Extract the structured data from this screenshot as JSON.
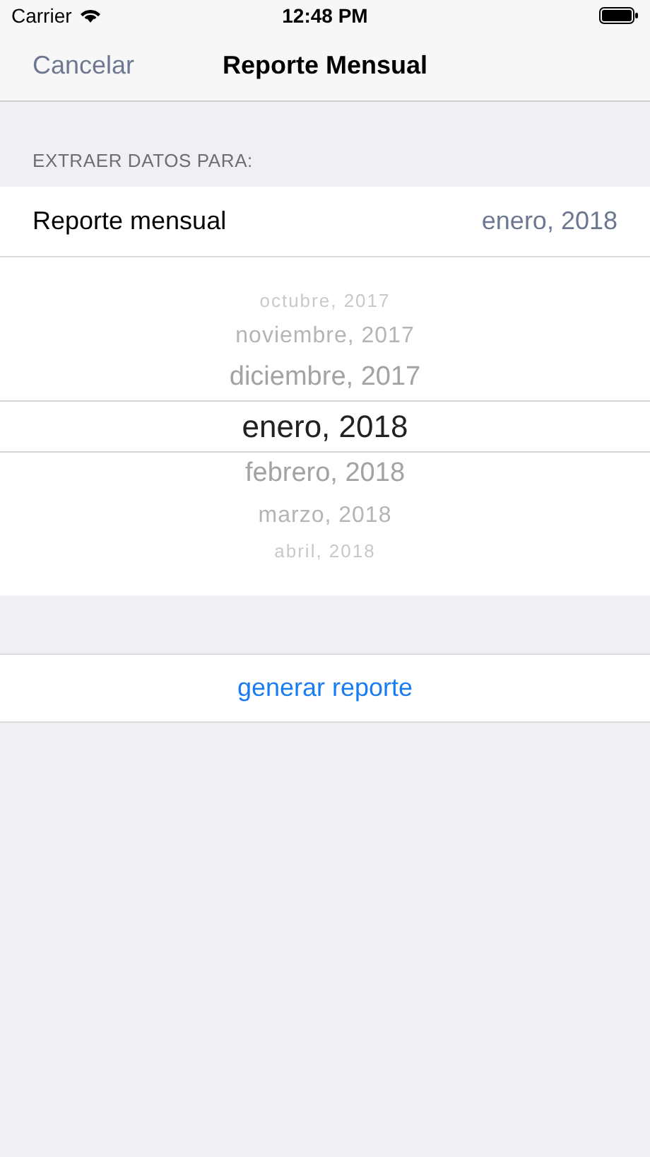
{
  "status_bar": {
    "carrier": "Carrier",
    "time": "12:48 PM"
  },
  "nav_bar": {
    "cancel": "Cancelar",
    "title": "Reporte Mensual"
  },
  "section_header": "EXTRAER DATOS PARA:",
  "row": {
    "label": "Reporte mensual",
    "value": "enero, 2018"
  },
  "picker": [
    {
      "label": "octubre, 2017",
      "selected": false
    },
    {
      "label": "noviembre, 2017",
      "selected": false
    },
    {
      "label": "diciembre, 2017",
      "selected": false
    },
    {
      "label": "enero, 2018",
      "selected": true
    },
    {
      "label": "febrero, 2018",
      "selected": false
    },
    {
      "label": "marzo, 2018",
      "selected": false
    },
    {
      "label": "abril, 2018",
      "selected": false
    }
  ],
  "action_button": "generar reporte"
}
